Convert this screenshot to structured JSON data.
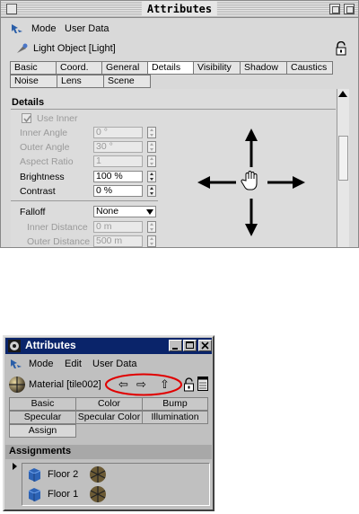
{
  "panel_top": {
    "title": "Attributes",
    "menu": [
      "Mode",
      "User Data"
    ],
    "object_label": "Light Object [Light]",
    "tabs_row1": [
      "Basic",
      "Coord.",
      "General",
      "Details",
      "Visibility",
      "Shadow",
      "Caustics"
    ],
    "tabs_row2": [
      "Noise",
      "Lens",
      "Scene"
    ],
    "section": "Details",
    "use_inner_label": "Use Inner",
    "fields": [
      {
        "label": "Inner Angle",
        "value": "0 °",
        "enabled": false
      },
      {
        "label": "Outer Angle",
        "value": "30 °",
        "enabled": false
      },
      {
        "label": "Aspect Ratio",
        "value": "1",
        "enabled": false
      },
      {
        "label": "Brightness",
        "value": "100 %",
        "enabled": true
      },
      {
        "label": "Contrast",
        "value": "0 %",
        "enabled": true
      }
    ],
    "falloff_label": "Falloff",
    "falloff_value": "None",
    "falloff_fields": [
      {
        "label": "Inner Distance",
        "value": "0 m",
        "enabled": false
      },
      {
        "label": "Outer Distance",
        "value": "500 m",
        "enabled": false
      }
    ]
  },
  "window_bottom": {
    "title": "Attributes",
    "menu": [
      "Mode",
      "Edit",
      "User Data"
    ],
    "material_label": "Material [tile002]",
    "nav_buttons": [
      "⇦",
      "⇨",
      "⇧"
    ],
    "tabs_row1": [
      "Basic",
      "Color",
      "Bump"
    ],
    "tabs_row2": [
      "Specular",
      "Specular Color",
      "Illumination"
    ],
    "tabs_row3": [
      "Assign"
    ],
    "assignments_title": "Assignments",
    "assignments": [
      "Floor 2",
      "Floor 1"
    ],
    "highlight_color": "#e00000"
  }
}
